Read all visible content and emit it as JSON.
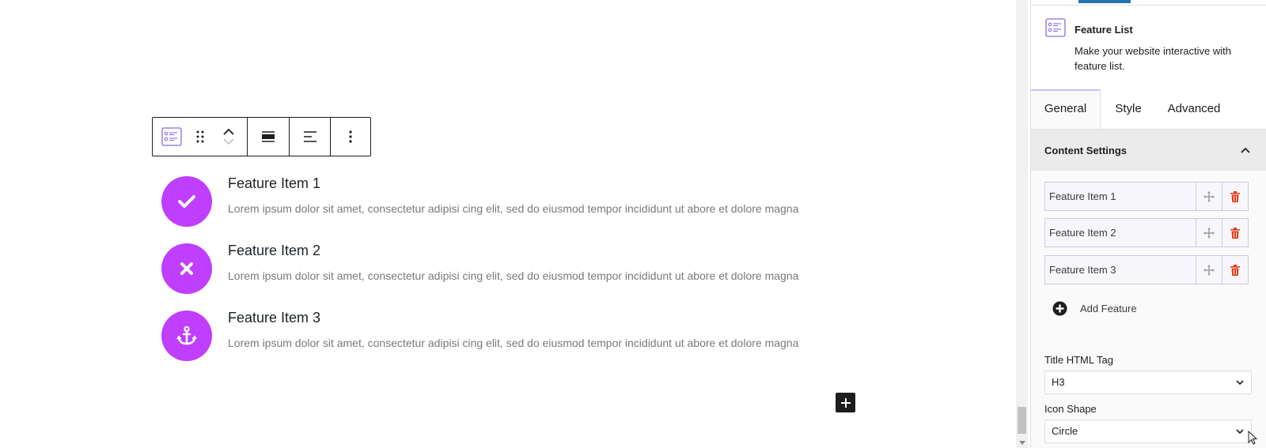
{
  "colors": {
    "accent": "#c03eff",
    "tab_indicator": "#2271b1",
    "delete": "#e2401c",
    "panel_header_bg": "#ebebeb"
  },
  "toolbar": {
    "buttons": [
      {
        "name": "block-type",
        "icon": "feature-list-icon"
      },
      {
        "name": "drag-handle",
        "icon": "drag-dots-icon"
      },
      {
        "name": "move-up",
        "icon": "chevron-up-icon"
      },
      {
        "name": "move-down",
        "icon": "chevron-down-icon"
      },
      {
        "name": "block-align",
        "icon": "align-full-width-icon"
      },
      {
        "name": "text-align",
        "icon": "align-left-icon"
      },
      {
        "name": "options",
        "icon": "more-vertical-icon"
      }
    ]
  },
  "features": [
    {
      "title": "Feature Item 1",
      "description": "Lorem ipsum dolor sit amet, consectetur adipisi cing elit, sed do eiusmod tempor incididunt ut abore et dolore magna",
      "icon": "check-icon"
    },
    {
      "title": "Feature Item 2",
      "description": "Lorem ipsum dolor sit amet, consectetur adipisi cing elit, sed do eiusmod tempor incididunt ut abore et dolore magna",
      "icon": "close-icon"
    },
    {
      "title": "Feature Item 3",
      "description": "Lorem ipsum dolor sit amet, consectetur adipisi cing elit, sed do eiusmod tempor incididunt ut abore et dolore magna",
      "icon": "anchor-icon"
    }
  ],
  "inserter": {
    "icon": "plus-icon"
  },
  "sidebar": {
    "block": {
      "title": "Feature List",
      "description": "Make your website interactive with feature list."
    },
    "tabs": [
      {
        "label": "General",
        "active": true
      },
      {
        "label": "Style",
        "active": false
      },
      {
        "label": "Advanced",
        "active": false
      }
    ],
    "panel": {
      "label": "Content Settings",
      "expanded": true,
      "repeater_items": [
        "Feature Item 1",
        "Feature Item 2",
        "Feature Item 3"
      ],
      "add_label": "Add Feature",
      "title_tag": {
        "label": "Title HTML Tag",
        "value": "H3"
      },
      "icon_shape": {
        "label": "Icon Shape",
        "value": "Circle"
      }
    }
  }
}
